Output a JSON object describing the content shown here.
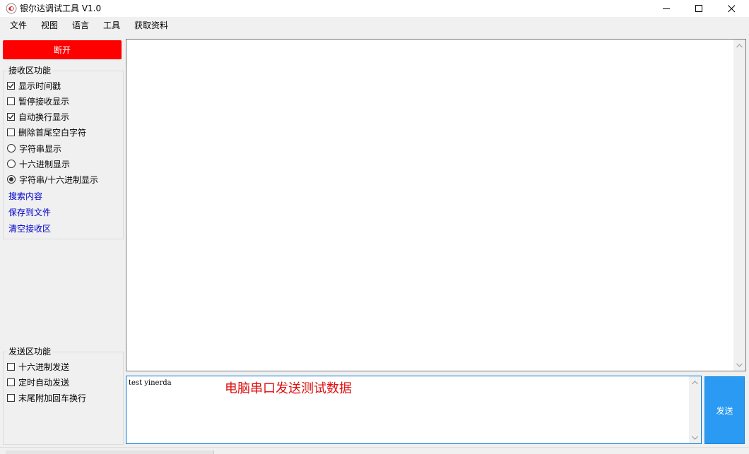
{
  "window": {
    "title": "银尔达调试工具 V1.0",
    "icon": "app-logo-icon",
    "controls": [
      "minimize-icon",
      "maximize-icon",
      "close-icon"
    ]
  },
  "menu": [
    "文件",
    "视图",
    "语言",
    "工具",
    "获取资料"
  ],
  "connect_button": {
    "label": "断开",
    "color": "#ff0000"
  },
  "receive_panel": {
    "legend": "接收区功能",
    "options": [
      {
        "type": "checkbox",
        "label": "显示时间戳",
        "checked": true
      },
      {
        "type": "checkbox",
        "label": "暂停接收显示",
        "checked": false
      },
      {
        "type": "checkbox",
        "label": "自动换行显示",
        "checked": true
      },
      {
        "type": "checkbox",
        "label": "删除首尾空白字符",
        "checked": false
      },
      {
        "type": "radio",
        "label": "字符串显示",
        "checked": false
      },
      {
        "type": "radio",
        "label": "十六进制显示",
        "checked": false
      },
      {
        "type": "radio",
        "label": "字符串/十六进制显示",
        "checked": true
      }
    ],
    "links": [
      "搜索内容",
      "保存到文件",
      "清空接收区"
    ]
  },
  "send_panel": {
    "legend": "发送区功能",
    "options": [
      {
        "type": "checkbox",
        "label": "十六进制发送",
        "checked": false
      },
      {
        "type": "checkbox",
        "label": "定时自动发送",
        "checked": false
      },
      {
        "type": "checkbox",
        "label": "末尾附加回车换行",
        "checked": false
      }
    ]
  },
  "receive_area": {
    "content": ""
  },
  "send_area": {
    "value": "test yinerda",
    "annotation": "电脑串口发送测试数据"
  },
  "send_button": {
    "label": "发送",
    "color": "#2b9af3"
  },
  "colors": {
    "link": "#0000cc",
    "annotation": "#e01010",
    "focus_border": "#0078d7"
  }
}
